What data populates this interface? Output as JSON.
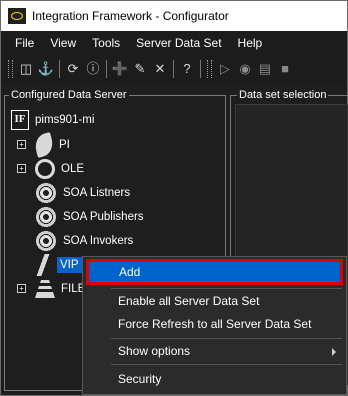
{
  "window": {
    "title": "Integration Framework - Configurator"
  },
  "menubar": {
    "items": [
      "File",
      "View",
      "Tools",
      "Server Data Set",
      "Help"
    ]
  },
  "toolbar": {
    "icons": [
      "grip-icon",
      "import-icon",
      "anchor-icon",
      "refresh-icon",
      "info-icon",
      "add-icon",
      "edit-icon",
      "delete-icon",
      "help-icon",
      "play-icon",
      "watch-icon",
      "script-icon",
      "stop-icon"
    ]
  },
  "left_panel": {
    "title": "Configured Data Server",
    "tree": {
      "root": "pims901-mi",
      "nodes": [
        {
          "label": "PI",
          "icon": "leaf-icon",
          "expandable": true
        },
        {
          "label": "OLE",
          "icon": "ole-icon",
          "expandable": true
        },
        {
          "label": "SOA Listners",
          "icon": "gear-icon",
          "expandable": false
        },
        {
          "label": "SOA Publishers",
          "icon": "gear-icon",
          "expandable": false
        },
        {
          "label": "SOA Invokers",
          "icon": "gear-icon",
          "expandable": false
        },
        {
          "label": "VIP",
          "icon": "vip-icon",
          "expandable": false,
          "selected": true
        },
        {
          "label": "FILE",
          "icon": "file-icon",
          "expandable": true
        }
      ]
    }
  },
  "right_panel": {
    "title": "Data set selection"
  },
  "context_menu": {
    "items": [
      {
        "label": "Add",
        "highlighted": true
      },
      {
        "label": "Enable all Server Data Set"
      },
      {
        "label": "Force Refresh to all Server Data Set"
      },
      {
        "label": "Show options",
        "submenu": true
      },
      {
        "label": "Security"
      }
    ]
  },
  "colors": {
    "background": "#1e1e1e",
    "selection": "#0a64c8",
    "highlight_border": "#e00000"
  }
}
